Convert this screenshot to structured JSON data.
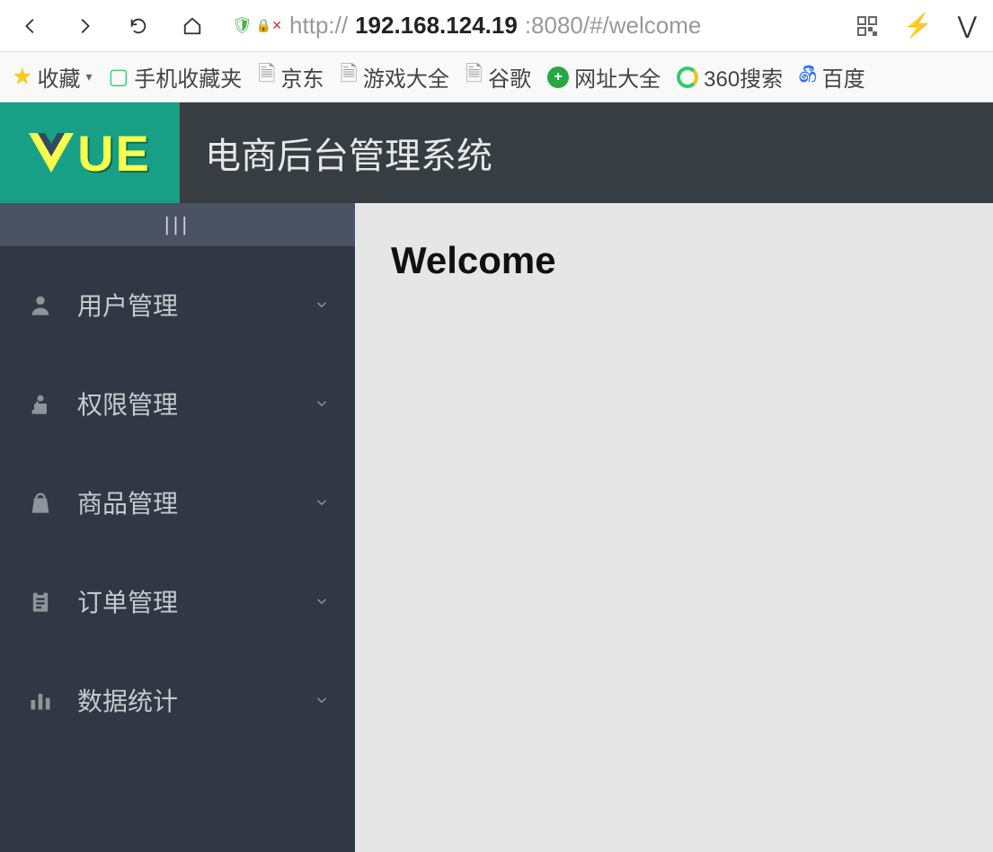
{
  "browser": {
    "url_prefix": "http://",
    "url_ip": "192.168.124.19",
    "url_suffix": ":8080/#/welcome"
  },
  "bookmarks": {
    "fav": "收藏",
    "mobile": "手机收藏夹",
    "jd": "京东",
    "game": "游戏大全",
    "google": "谷歌",
    "nav": "网址大全",
    "s360": "360搜索",
    "baidu": "百度"
  },
  "header": {
    "logo": "VUE",
    "title": "电商后台管理系统"
  },
  "sidebar": {
    "collapse": "|||",
    "items": [
      {
        "label": "用户管理",
        "icon": "user"
      },
      {
        "label": "权限管理",
        "icon": "key"
      },
      {
        "label": "商品管理",
        "icon": "bag"
      },
      {
        "label": "订单管理",
        "icon": "clipboard"
      },
      {
        "label": "数据统计",
        "icon": "chart"
      }
    ]
  },
  "main": {
    "heading": "Welcome"
  }
}
